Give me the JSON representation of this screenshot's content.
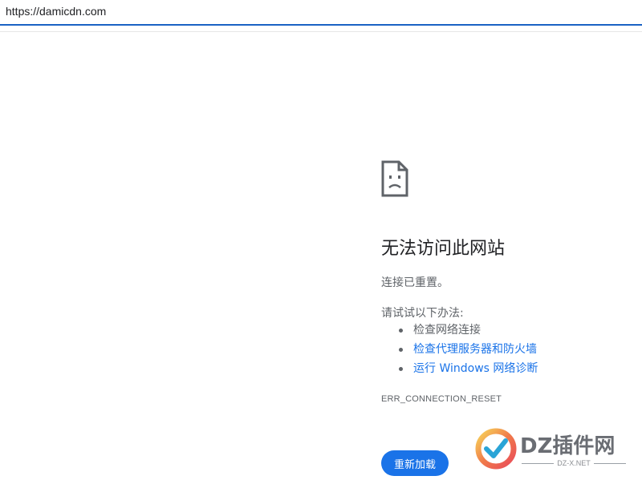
{
  "browser": {
    "url": "https://damicdn.com"
  },
  "error_page": {
    "icon": "sad-page-icon",
    "title": "无法访问此网站",
    "subtitle": "连接已重置。",
    "suggestions_heading": "请试试以下办法:",
    "suggestions": [
      {
        "label": "检查网络连接",
        "is_link": false
      },
      {
        "label": "检查代理服务器和防火墙",
        "is_link": true
      },
      {
        "label": "运行 Windows 网络诊断",
        "is_link": true
      }
    ],
    "error_code": "ERR_CONNECTION_RESET",
    "reload_label": "重新加载"
  },
  "watermark": {
    "brand": "DZ插件网",
    "sub": "DZ-X.NET"
  },
  "colors": {
    "accent": "#1a73e8",
    "address_bar_border": "#1a62c4",
    "text_secondary": "#5f6368"
  }
}
